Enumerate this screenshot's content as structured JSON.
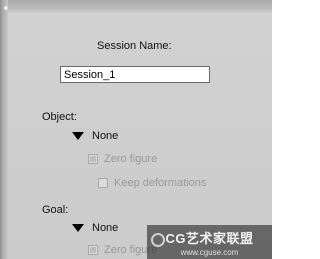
{
  "session": {
    "name_label": "Session Name:",
    "name_value": "Session_1"
  },
  "object": {
    "label": "Object:",
    "selected": "None",
    "zero_figure_label": "Zero figure",
    "zero_figure_checked": true,
    "keep_deformations_label": "Keep deformations",
    "keep_deformations_checked": false
  },
  "goal": {
    "label": "Goal:",
    "selected": "None",
    "zero_figure_label": "Zero figure"
  },
  "watermark": {
    "title": "CG艺术家联盟",
    "url": "www.cguse.com"
  },
  "colors": {
    "panel_bg": "#d0d0d0",
    "disabled_text": "#9a9a9a"
  }
}
